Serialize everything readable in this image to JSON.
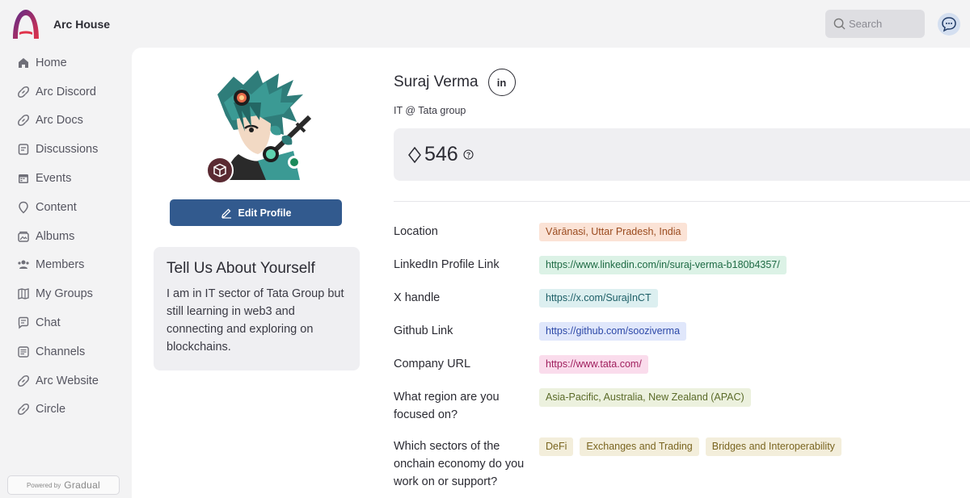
{
  "app": {
    "name": "Arc House"
  },
  "search": {
    "placeholder": "Search"
  },
  "sidebar": {
    "items": [
      {
        "label": "Home",
        "icon": "home-icon"
      },
      {
        "label": "Arc Discord",
        "icon": "link-icon"
      },
      {
        "label": "Arc Docs",
        "icon": "link-icon"
      },
      {
        "label": "Discussions",
        "icon": "discussions-icon"
      },
      {
        "label": "Events",
        "icon": "calendar-icon"
      },
      {
        "label": "Content",
        "icon": "content-icon"
      },
      {
        "label": "Albums",
        "icon": "album-icon"
      },
      {
        "label": "Members",
        "icon": "members-icon"
      },
      {
        "label": "My Groups",
        "icon": "groups-icon"
      },
      {
        "label": "Chat",
        "icon": "chat-icon"
      },
      {
        "label": "Channels",
        "icon": "channels-icon"
      },
      {
        "label": "Arc Website",
        "icon": "link-icon"
      },
      {
        "label": "Circle",
        "icon": "link-icon"
      }
    ],
    "powered_by": {
      "prefix": "Powered by",
      "brand": "Gradual"
    }
  },
  "profile": {
    "name": "Suraj Verma",
    "linkedin_label": "in",
    "headline": "IT @ Tata group",
    "points": "546",
    "edit_button": "Edit Profile",
    "about": {
      "title": "Tell Us About Yourself",
      "text": "I am in IT sector of Tata Group but still learning in web3 and connecting and exploring on blockchains."
    },
    "fields": [
      {
        "label": "Location",
        "tags": [
          {
            "text": "Vārānasi, Uttar Pradesh, India",
            "bg": "#fbe3d6",
            "fg": "#9a4a1e"
          }
        ]
      },
      {
        "label": "LinkedIn Profile Link",
        "tags": [
          {
            "text": "https://www.linkedin.com/in/suraj-verma-b180b4357/",
            "bg": "#dcf2e6",
            "fg": "#1f6b45"
          }
        ]
      },
      {
        "label": "X handle",
        "tags": [
          {
            "text": "https://x.com/SurajInCT",
            "bg": "#dceff0",
            "fg": "#1c5e66"
          }
        ]
      },
      {
        "label": "Github Link",
        "tags": [
          {
            "text": "https://github.com/sooziverma",
            "bg": "#e0e7fb",
            "fg": "#2d49a8"
          }
        ]
      },
      {
        "label": "Company URL",
        "tags": [
          {
            "text": "https://www.tata.com/",
            "bg": "#fadcec",
            "fg": "#a0205e"
          }
        ]
      },
      {
        "label": "What region are you focused on?",
        "tags": [
          {
            "text": "Asia-Pacific, Australia, New Zealand (APAC)",
            "bg": "#ecf1de",
            "fg": "#5a6a28"
          }
        ]
      },
      {
        "label": "Which sectors of the onchain economy do you work on or support?",
        "tags": [
          {
            "text": "DeFi",
            "bg": "#f3eedb",
            "fg": "#7a6520"
          },
          {
            "text": "Exchanges and Trading",
            "bg": "#f3eedb",
            "fg": "#7a6520"
          },
          {
            "text": "Bridges and Interoperability",
            "bg": "#f3eedb",
            "fg": "#7a6520"
          }
        ]
      }
    ]
  },
  "colors": {
    "primary": "#325a8e",
    "online": "#1a8a5a",
    "brand_gradient": [
      "#6b2a86",
      "#e0324a"
    ]
  }
}
